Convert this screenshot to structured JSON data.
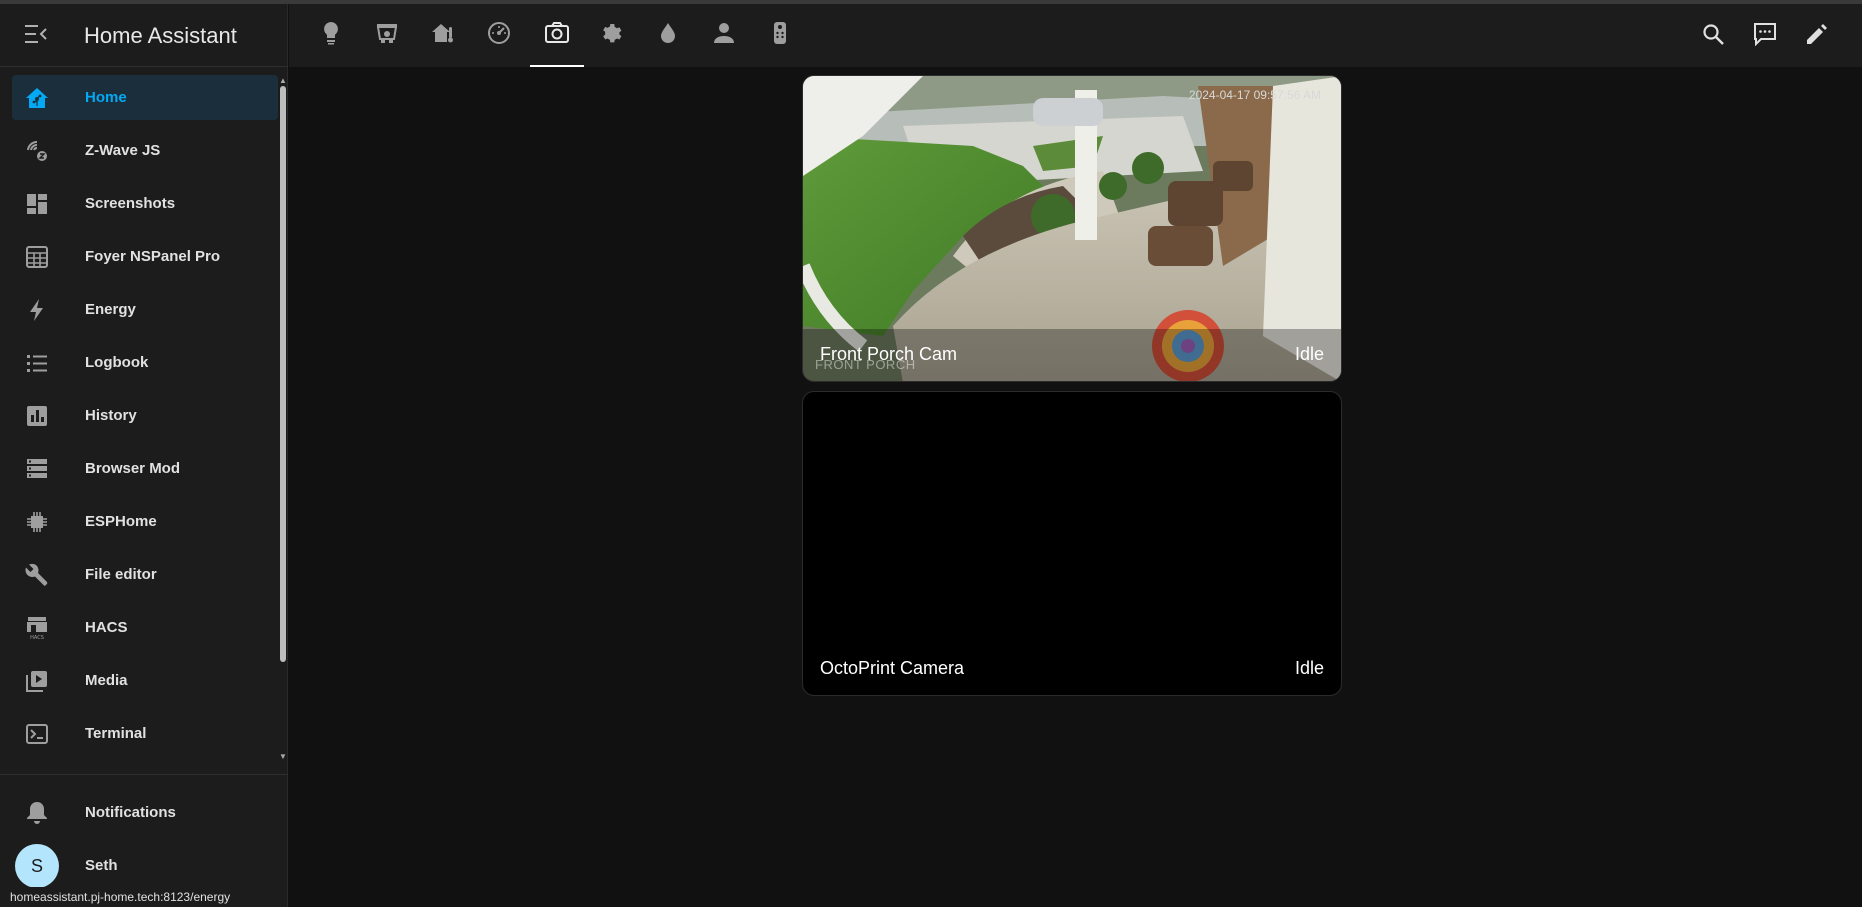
{
  "app": {
    "title": "Home Assistant"
  },
  "sidebar": {
    "items": [
      {
        "label": "Home",
        "icon": "home-assistant-icon",
        "active": true
      },
      {
        "label": "Z-Wave JS",
        "icon": "z-wave-icon"
      },
      {
        "label": "Screenshots",
        "icon": "dashboard-icon"
      },
      {
        "label": "Foyer NSPanel Pro",
        "icon": "table-grid-icon"
      },
      {
        "label": "Energy",
        "icon": "lightning-bolt-icon"
      },
      {
        "label": "Logbook",
        "icon": "list-icon"
      },
      {
        "label": "History",
        "icon": "chart-box-icon"
      },
      {
        "label": "Browser Mod",
        "icon": "server-icon"
      },
      {
        "label": "ESPHome",
        "icon": "chip-icon"
      },
      {
        "label": "File editor",
        "icon": "wrench-icon"
      },
      {
        "label": "HACS",
        "icon": "hacs-icon"
      },
      {
        "label": "Media",
        "icon": "media-play-icon"
      },
      {
        "label": "Terminal",
        "icon": "terminal-icon"
      }
    ],
    "notifications_label": "Notifications",
    "user": {
      "name": "Seth",
      "initial": "S"
    }
  },
  "status_bar": {
    "url": "homeassistant.pj-home.tech:8123/energy"
  },
  "topbar": {
    "views": [
      {
        "icon": "lightbulb-icon"
      },
      {
        "icon": "robot-vacuum-icon"
      },
      {
        "icon": "home-thermometer-icon"
      },
      {
        "icon": "gauge-icon"
      },
      {
        "icon": "camera-icon",
        "active": true
      },
      {
        "icon": "cog-icon"
      },
      {
        "icon": "water-drop-icon"
      },
      {
        "icon": "account-icon"
      },
      {
        "icon": "remote-icon"
      }
    ],
    "tools": [
      {
        "icon": "search-icon"
      },
      {
        "icon": "assist-chat-icon"
      },
      {
        "icon": "pencil-icon"
      }
    ]
  },
  "cameras": [
    {
      "name": "Front Porch Cam",
      "state": "Idle",
      "timestamp": "2024-04-17 09:57:56 AM",
      "watermark": "FRONT PORCH"
    },
    {
      "name": "OctoPrint Camera",
      "state": "Idle"
    }
  ],
  "colors": {
    "accent": "#03a9f4",
    "sidebar_bg": "#1c1c1c",
    "page_bg": "#111111",
    "avatar_bg": "#b3e5fc"
  }
}
